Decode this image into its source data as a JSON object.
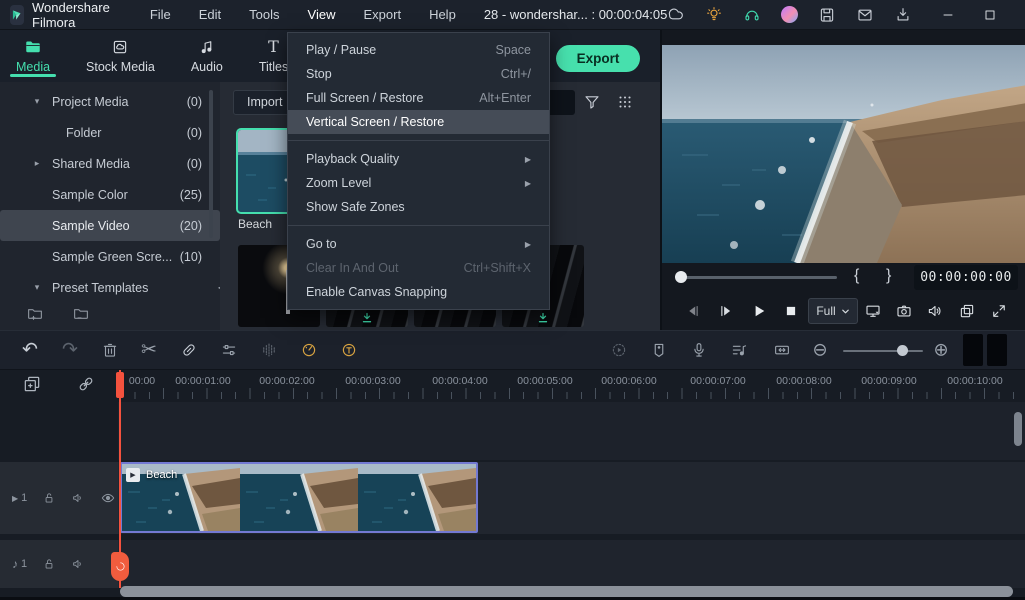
{
  "titlebar": {
    "app_name": "Wondershare Filmora",
    "menus": [
      "File",
      "Edit",
      "Tools",
      "View",
      "Export",
      "Help"
    ],
    "active_menu": "View",
    "document_title": "28 - wondershar... : 00:00:04:05"
  },
  "tabs": [
    {
      "label": "Media",
      "active": true
    },
    {
      "label": "Stock Media",
      "active": false
    },
    {
      "label": "Audio",
      "active": false
    },
    {
      "label": "Titles",
      "active": false
    }
  ],
  "export_button": "Export",
  "sidebar": {
    "items": [
      {
        "caret": "▾",
        "label": "Project Media",
        "count": "(0)"
      },
      {
        "caret": "",
        "label": "Folder",
        "count": "(0)"
      },
      {
        "caret": "▸",
        "label": "Shared Media",
        "count": "(0)"
      },
      {
        "caret": "",
        "label": "Sample Color",
        "count": "(25)"
      },
      {
        "caret": "",
        "label": "Sample Video",
        "count": "(20)",
        "selected": true
      },
      {
        "caret": "",
        "label": "Sample Green Scre...",
        "count": "(10)"
      },
      {
        "caret": "▾",
        "label": "Preset Templates",
        "count": ""
      }
    ]
  },
  "media_panel": {
    "import_label": "Import",
    "items": [
      {
        "name": "Beach",
        "selected": true
      }
    ]
  },
  "view_menu": {
    "items": [
      {
        "label": "Play / Pause",
        "shortcut": "Space"
      },
      {
        "label": "Stop",
        "shortcut": "Ctrl+/"
      },
      {
        "label": "Full Screen / Restore",
        "shortcut": "Alt+Enter"
      },
      {
        "label": "Vertical Screen / Restore",
        "highlighted": true
      },
      {
        "label": "Playback Quality",
        "submenu": true
      },
      {
        "label": "Zoom Level",
        "submenu": true
      },
      {
        "label": "Show Safe Zones"
      },
      {
        "label": "Go to",
        "submenu": true
      },
      {
        "label": "Clear In And Out",
        "shortcut": "Ctrl+Shift+X",
        "disabled": true
      },
      {
        "label": "Enable Canvas Snapping"
      }
    ]
  },
  "preview": {
    "timecode": "00:00:00:00",
    "quality": "Full",
    "mark_in": "{",
    "mark_out": "}"
  },
  "timeline": {
    "ruler_labels": [
      "00:00",
      "00:00:01:00",
      "00:00:02:00",
      "00:00:03:00",
      "00:00:04:00",
      "00:00:05:00",
      "00:00:06:00",
      "00:00:07:00",
      "00:00:08:00",
      "00:00:09:00",
      "00:00:10:00"
    ],
    "clip": {
      "name": "Beach"
    },
    "video_track_number": "1",
    "audio_track_number": "1"
  },
  "icons": {
    "undo": "↶",
    "redo": "↷",
    "scissors": "✂",
    "zoom_out": "⊖",
    "zoom_in": "⊕",
    "submenu_arrow": "▶",
    "collapse_left": "◀",
    "play_small": "▶",
    "note": "♪"
  },
  "colors": {
    "accent": "#45dfae",
    "playhead": "#f4523e",
    "export_bg": "#47e0ad"
  }
}
